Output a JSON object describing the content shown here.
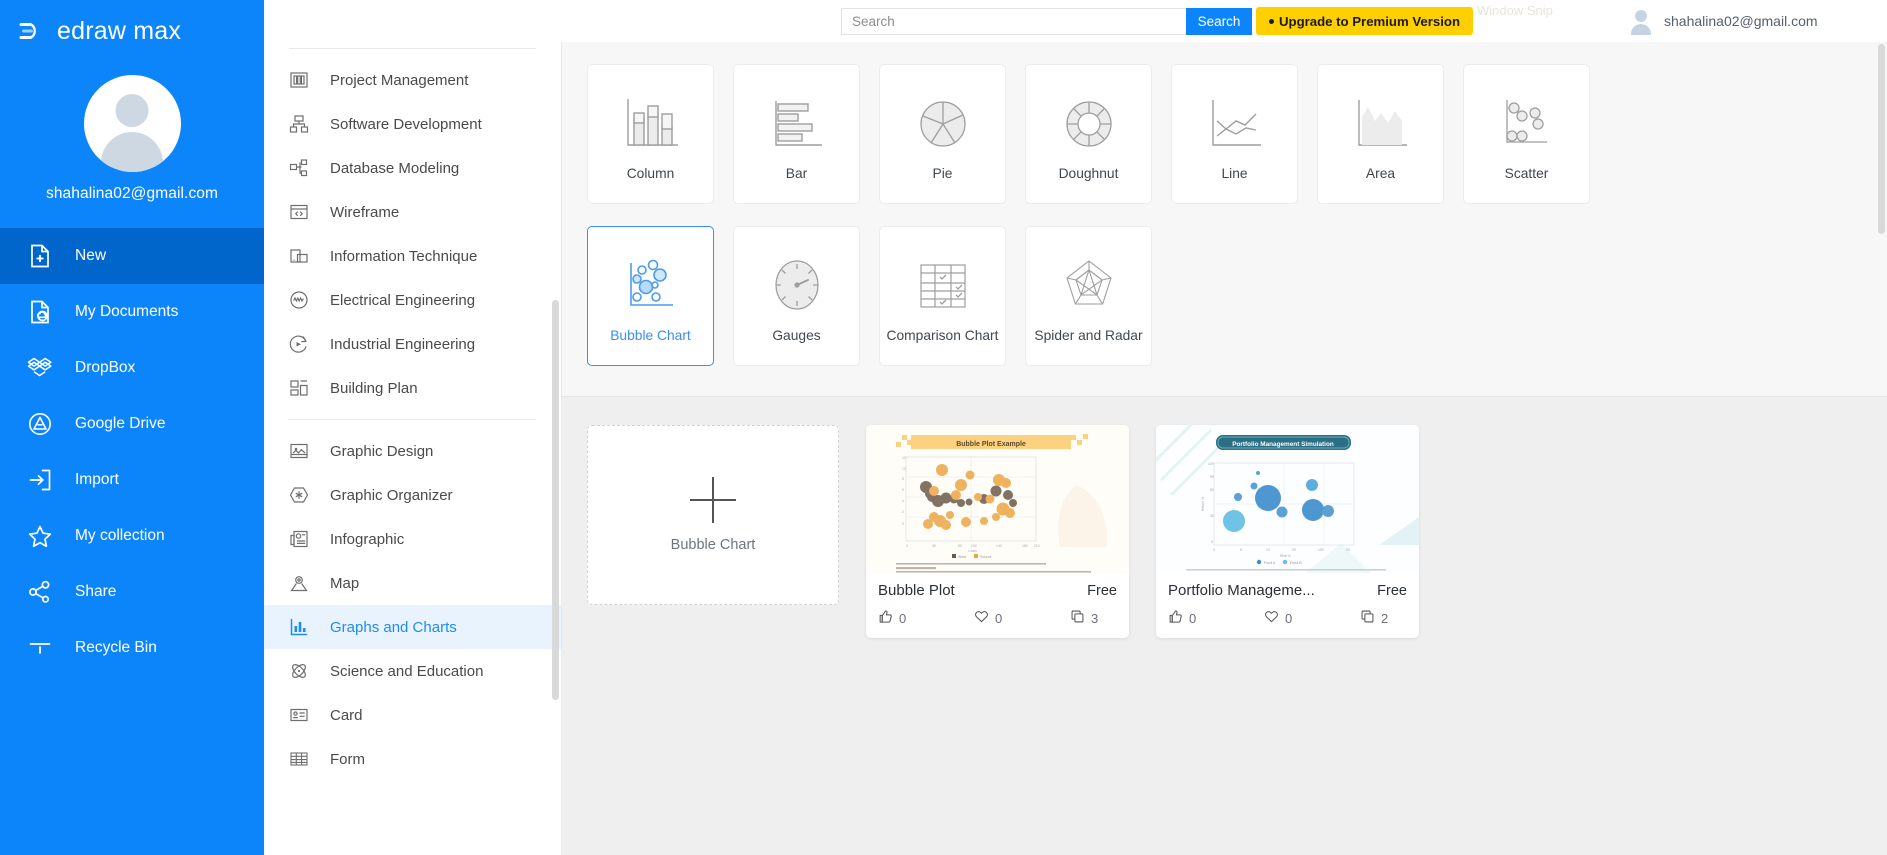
{
  "brand": {
    "name": "edraw max",
    "logo_icon": "edraw-logo-icon"
  },
  "sidebar": {
    "user_email": "shahalina02@gmail.com",
    "avatar_icon": "user-avatar-icon",
    "items": [
      {
        "label": "New",
        "icon": "new-document-icon",
        "active": true
      },
      {
        "label": "My Documents",
        "icon": "cloud-document-icon",
        "active": false
      },
      {
        "label": "DropBox",
        "icon": "dropbox-icon",
        "active": false
      },
      {
        "label": "Google Drive",
        "icon": "google-drive-icon",
        "active": false
      },
      {
        "label": "Import",
        "icon": "import-arrow-icon",
        "active": false
      },
      {
        "label": "My collection",
        "icon": "star-icon",
        "active": false
      },
      {
        "label": "Share",
        "icon": "share-nodes-icon",
        "active": false
      },
      {
        "label": "Recycle Bin",
        "icon": "recycle-bin-icon",
        "active": false
      }
    ]
  },
  "categories": {
    "group1": [
      {
        "label": "Project Management",
        "icon": "gantt-chart-icon"
      },
      {
        "label": "Software Development",
        "icon": "org-tree-icon"
      },
      {
        "label": "Database Modeling",
        "icon": "database-nodes-icon"
      },
      {
        "label": "Wireframe",
        "icon": "browser-code-icon"
      },
      {
        "label": "Information Technique",
        "icon": "devices-icon"
      },
      {
        "label": "Electrical Engineering",
        "icon": "waveform-circle-icon"
      },
      {
        "label": "Industrial Engineering",
        "icon": "process-cycle-icon"
      },
      {
        "label": "Building Plan",
        "icon": "floorplan-icon"
      }
    ],
    "group2": [
      {
        "label": "Graphic Design",
        "icon": "image-frame-icon",
        "active": false
      },
      {
        "label": "Graphic Organizer",
        "icon": "hexagon-star-icon",
        "active": false
      },
      {
        "label": "Infographic",
        "icon": "infographic-icon",
        "active": false
      },
      {
        "label": "Map",
        "icon": "map-pin-icon",
        "active": false
      },
      {
        "label": "Graphs and Charts",
        "icon": "bar-chart-icon",
        "active": true
      },
      {
        "label": "Science and Education",
        "icon": "atom-icon",
        "active": false
      },
      {
        "label": "Card",
        "icon": "id-card-icon",
        "active": false
      },
      {
        "label": "Form",
        "icon": "table-grid-icon",
        "active": false
      }
    ]
  },
  "topbar": {
    "search_placeholder": "Search",
    "search_value": "",
    "search_button": "Search",
    "upgrade_label": "Upgrade to Premium Version",
    "user_email": "shahalina02@gmail.com",
    "watermark": "Window Snip",
    "avatar_icon": "user-avatar-icon",
    "accent_blue": "#0d85fa",
    "accent_yellow": "#ffcf00"
  },
  "chart_types": {
    "row1": [
      {
        "label": "Column",
        "icon": "column-chart-icon",
        "selected": false
      },
      {
        "label": "Bar",
        "icon": "bar-chart-icon",
        "selected": false
      },
      {
        "label": "Pie",
        "icon": "pie-chart-icon",
        "selected": false
      },
      {
        "label": "Doughnut",
        "icon": "doughnut-chart-icon",
        "selected": false
      },
      {
        "label": "Line",
        "icon": "line-chart-icon",
        "selected": false
      },
      {
        "label": "Area",
        "icon": "area-chart-icon",
        "selected": false
      },
      {
        "label": "Scatter",
        "icon": "scatter-chart-icon",
        "selected": false
      }
    ],
    "row2": [
      {
        "label": "Bubble Chart",
        "icon": "bubble-chart-icon",
        "selected": true
      },
      {
        "label": "Gauges",
        "icon": "gauge-icon",
        "selected": false
      },
      {
        "label": "Comparison Chart",
        "icon": "comparison-table-icon",
        "selected": false
      },
      {
        "label": "Spider and Radar",
        "icon": "radar-chart-icon",
        "selected": false
      }
    ]
  },
  "templates": {
    "new_card": {
      "label": "Bubble Chart",
      "icon": "plus-icon"
    },
    "items": [
      {
        "title": "Bubble Plot",
        "price": "Free",
        "likes": "0",
        "favorites": "0",
        "copies": "3",
        "thumb_title": "Bubble Plot Example",
        "thumb_theme": "orange"
      },
      {
        "title": "Portfolio Manageme...",
        "price": "Free",
        "likes": "0",
        "favorites": "0",
        "copies": "2",
        "thumb_title": "Portfolio Management Simulation",
        "thumb_theme": "blue"
      }
    ],
    "stat_icons": {
      "like": "thumbs-up-icon",
      "favorite": "heart-icon",
      "copy": "copy-icon"
    }
  }
}
